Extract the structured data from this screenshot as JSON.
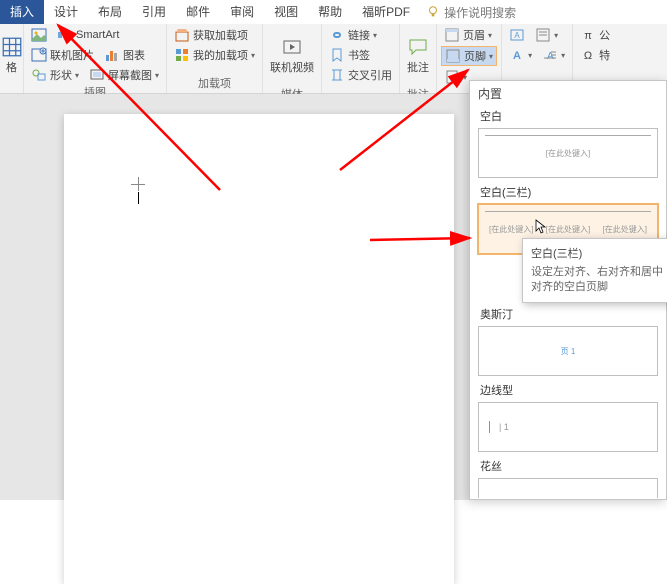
{
  "tabs": {
    "active": "插入",
    "items": [
      "插入",
      "设计",
      "布局",
      "引用",
      "邮件",
      "审阅",
      "视图",
      "帮助",
      "福昕PDF"
    ],
    "tell_me": "操作说明搜索"
  },
  "ribbon": {
    "group1": {
      "btn_table": "格",
      "btn_space": ""
    },
    "group2": {
      "label": "插图",
      "btn_pic_system": "",
      "btn_online_pic": "联机图片",
      "btn_shapes": "形状",
      "btn_smartart": "SmartArt",
      "btn_chart": "图表",
      "btn_screenshot": "屏幕截图"
    },
    "group3": {
      "label": "加载项",
      "btn_get": "获取加载项",
      "btn_my": "我的加载项"
    },
    "group4": {
      "label": "媒体",
      "btn_video": "联机视频"
    },
    "group5": {
      "label": "",
      "btn_link": "链接",
      "btn_bookmark": "书签",
      "btn_crossref": "交叉引用"
    },
    "group6": {
      "label": "批注",
      "btn_comment": "批注"
    },
    "group7": {
      "btn_header": "页眉",
      "btn_footer": "页脚",
      "btn_pagenum": ""
    },
    "group8": {
      "btn_textbox": "",
      "btn_wordart": ""
    },
    "group9": {
      "btn_eq": "公",
      "btn_sym": "特"
    }
  },
  "gallery": {
    "section_builtin": "内置",
    "items": [
      {
        "label": "空白",
        "placeholder": "[在此处键入]"
      },
      {
        "label": "空白(三栏)",
        "placeholders": [
          "[在此处键入]",
          "[在此处键入]",
          "[在此处键入]"
        ]
      },
      {
        "label": "奥斯汀",
        "placeholder": "页 1"
      },
      {
        "label": "边线型",
        "placeholder": "| 1"
      },
      {
        "label": "花丝",
        "placeholder": ""
      }
    ],
    "tooltip": {
      "title": "空白(三栏)",
      "desc": "设定左对齐、右对齐和居中对齐的空白页脚"
    }
  }
}
